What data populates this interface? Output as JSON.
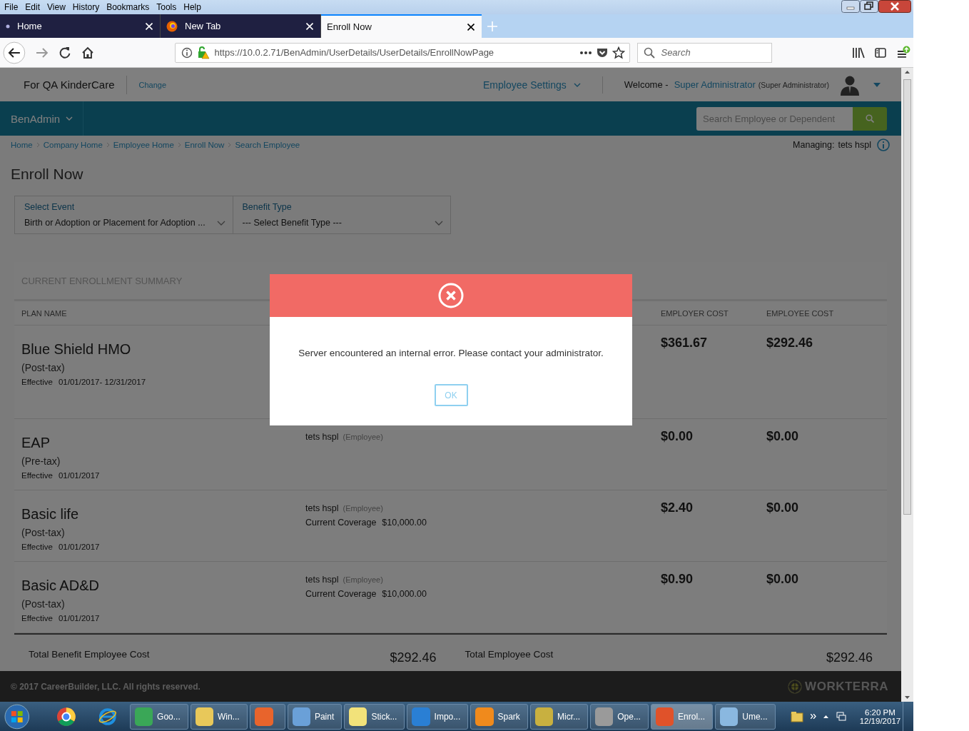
{
  "menubar": [
    "File",
    "Edit",
    "View",
    "History",
    "Bookmarks",
    "Tools",
    "Help"
  ],
  "tabs": [
    {
      "label": "Home",
      "selected": false,
      "kind": "dot"
    },
    {
      "label": "New Tab",
      "selected": false,
      "kind": "browser"
    },
    {
      "label": "Enroll Now",
      "selected": true,
      "kind": "plain"
    }
  ],
  "address_bar": {
    "url": "https://10.0.2.71/BenAdmin/UserDetails/UserDetails/EnrollNowPage"
  },
  "search_bar": {
    "placeholder": "Search"
  },
  "header": {
    "company": "For QA KinderCare",
    "change_link": "Change",
    "settings_menu": "Employee Settings",
    "welcome": "Welcome -",
    "user": "Super Administrator",
    "role": "(Super Administrator)"
  },
  "app_bar": {
    "app": "BenAdmin",
    "search_placeholder": "Search Employee or Dependent"
  },
  "breadcrumbs": [
    "Home",
    "Company Home",
    "Employee Home",
    "Enroll Now",
    "Search Employee"
  ],
  "managing": {
    "label": "Managing:",
    "value": "tets hspl"
  },
  "title": "Enroll Now",
  "filters": [
    {
      "label": "Select Event",
      "value": "Birth or Adoption or Placement for Adoption ..."
    },
    {
      "label": "Benefit Type",
      "value": "--- Select Benefit Type ---"
    }
  ],
  "summary": {
    "title": "CURRENT ENROLLMENT SUMMARY",
    "columns": {
      "plan_name": "PLAN NAME",
      "employer_cost": "EMPLOYER COST",
      "employee_cost": "EMPLOYEE COST"
    },
    "rows": [
      {
        "plan": "Blue Shield HMO",
        "tax": "(Post-tax)",
        "effective_label": "Effective",
        "effective": "01/01/2017- 12/31/2017",
        "employer_cost": "$361.67",
        "employee_cost": "$292.46"
      },
      {
        "plan": "EAP",
        "tax": "(Pre-tax)",
        "effective_label": "Effective",
        "effective": "01/01/2017",
        "member": "tets hspl",
        "member_role": "(Employee)",
        "employer_cost": "$0.00",
        "employee_cost": "$0.00"
      },
      {
        "plan": "Basic life",
        "tax": "(Post-tax)",
        "effective_label": "Effective",
        "effective": "01/01/2017",
        "member": "tets hspl",
        "member_role": "(Employee)",
        "coverage_label": "Current Coverage",
        "coverage": "$10,000.00",
        "employer_cost": "$2.40",
        "employee_cost": "$0.00"
      },
      {
        "plan": "Basic AD&D",
        "tax": "(Post-tax)",
        "effective_label": "Effective",
        "effective": "01/01/2017",
        "member": "tets hspl",
        "member_role": "(Employee)",
        "coverage_label": "Current Coverage",
        "coverage": "$10,000.00",
        "employer_cost": "$0.90",
        "employee_cost": "$0.00"
      }
    ],
    "totals": [
      {
        "label": "Total Benefit Employee Cost",
        "value": "$292.46"
      },
      {
        "label": "Total Employee Cost",
        "value": "$292.46"
      }
    ]
  },
  "footer": {
    "copyright": "© 2017 CareerBuilder, LLC. All rights reserved.",
    "logo": "WORKTERRA"
  },
  "modal": {
    "message": "Server encountered an internal error. Please contact your administrator.",
    "button": "OK"
  },
  "taskbar": {
    "items": [
      {
        "label": "Goo...",
        "color": "#3aa757",
        "selected": false
      },
      {
        "label": "Win...",
        "color": "#e8c85a",
        "selected": false
      },
      {
        "color": "#e8642c",
        "selected": false
      },
      {
        "label": "Paint",
        "color": "#6aa0d8",
        "selected": false
      },
      {
        "label": "Stick...",
        "color": "#f2e27a",
        "selected": false
      },
      {
        "label": "Impo...",
        "color": "#2a7fd4",
        "selected": false
      },
      {
        "label": "Spark",
        "color": "#f08a1c",
        "selected": false
      },
      {
        "label": "Micr...",
        "color": "#c8b040",
        "selected": false
      },
      {
        "label": "Ope...",
        "color": "#9a9a9a",
        "selected": false
      },
      {
        "label": "Enrol...",
        "color": "#e0522a",
        "selected": true
      },
      {
        "label": "Ume...",
        "color": "#8ab8e0",
        "selected": false
      }
    ],
    "time": "6:20 PM",
    "date": "12/19/2017"
  }
}
